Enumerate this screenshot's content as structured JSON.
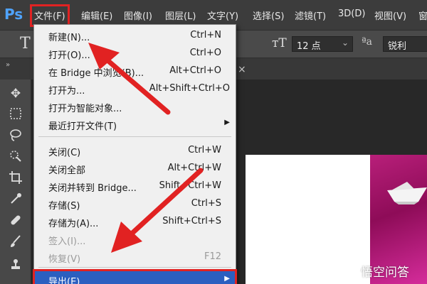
{
  "app": {
    "logo": "Ps"
  },
  "menubar": {
    "items": [
      "文件(F)",
      "编辑(E)",
      "图像(I)",
      "图层(L)",
      "文字(Y)",
      "选择(S)",
      "滤镜(T)",
      "3D(D)",
      "视图(V)",
      "窗"
    ]
  },
  "options": {
    "tool_glyph": "T",
    "size_icon": "ᴛT",
    "font_size": "12 点",
    "aa_icon": "ªa",
    "antialias": "锐利"
  },
  "tabs": {
    "close_glyph": "×"
  },
  "file_menu": {
    "items": [
      {
        "label": "新建(N)...",
        "shortcut": "Ctrl+N"
      },
      {
        "label": "打开(O)...",
        "shortcut": "Ctrl+O"
      },
      {
        "label": "在 Bridge 中浏览(B)...",
        "shortcut": "Alt+Ctrl+O"
      },
      {
        "label": "打开为...",
        "shortcut": "Alt+Shift+Ctrl+O"
      },
      {
        "label": "打开为智能对象...",
        "shortcut": ""
      },
      {
        "label": "最近打开文件(T)",
        "shortcut": "",
        "submenu": true
      },
      {
        "label": "关闭(C)",
        "shortcut": "Ctrl+W"
      },
      {
        "label": "关闭全部",
        "shortcut": "Alt+Ctrl+W"
      },
      {
        "label": "关闭并转到 Bridge...",
        "shortcut": "Shift+Ctrl+W"
      },
      {
        "label": "存储(S)",
        "shortcut": "Ctrl+S"
      },
      {
        "label": "存储为(A)...",
        "shortcut": "Shift+Ctrl+S"
      },
      {
        "label": "签入(I)...",
        "shortcut": "",
        "disabled": true
      },
      {
        "label": "恢复(V)",
        "shortcut": "F12",
        "disabled": true
      },
      {
        "label": "导出(E)",
        "shortcut": "",
        "submenu": true,
        "highlighted": true
      }
    ]
  },
  "watermark": {
    "text": "悟空问答"
  },
  "colors": {
    "annotation_red": "#e12222",
    "menu_highlight": "#2b5fc0",
    "ps_blue": "#4fa3ff",
    "canvas_magenta": "#b81f7a"
  },
  "icons": [
    "move-icon",
    "marquee-icon",
    "lasso-icon",
    "quick-select-icon",
    "crop-icon",
    "eyedropper-icon",
    "healing-brush-icon",
    "brush-icon",
    "stamp-icon",
    "submenu-arrow-icon",
    "close-icon",
    "chevron-down-icon"
  ]
}
